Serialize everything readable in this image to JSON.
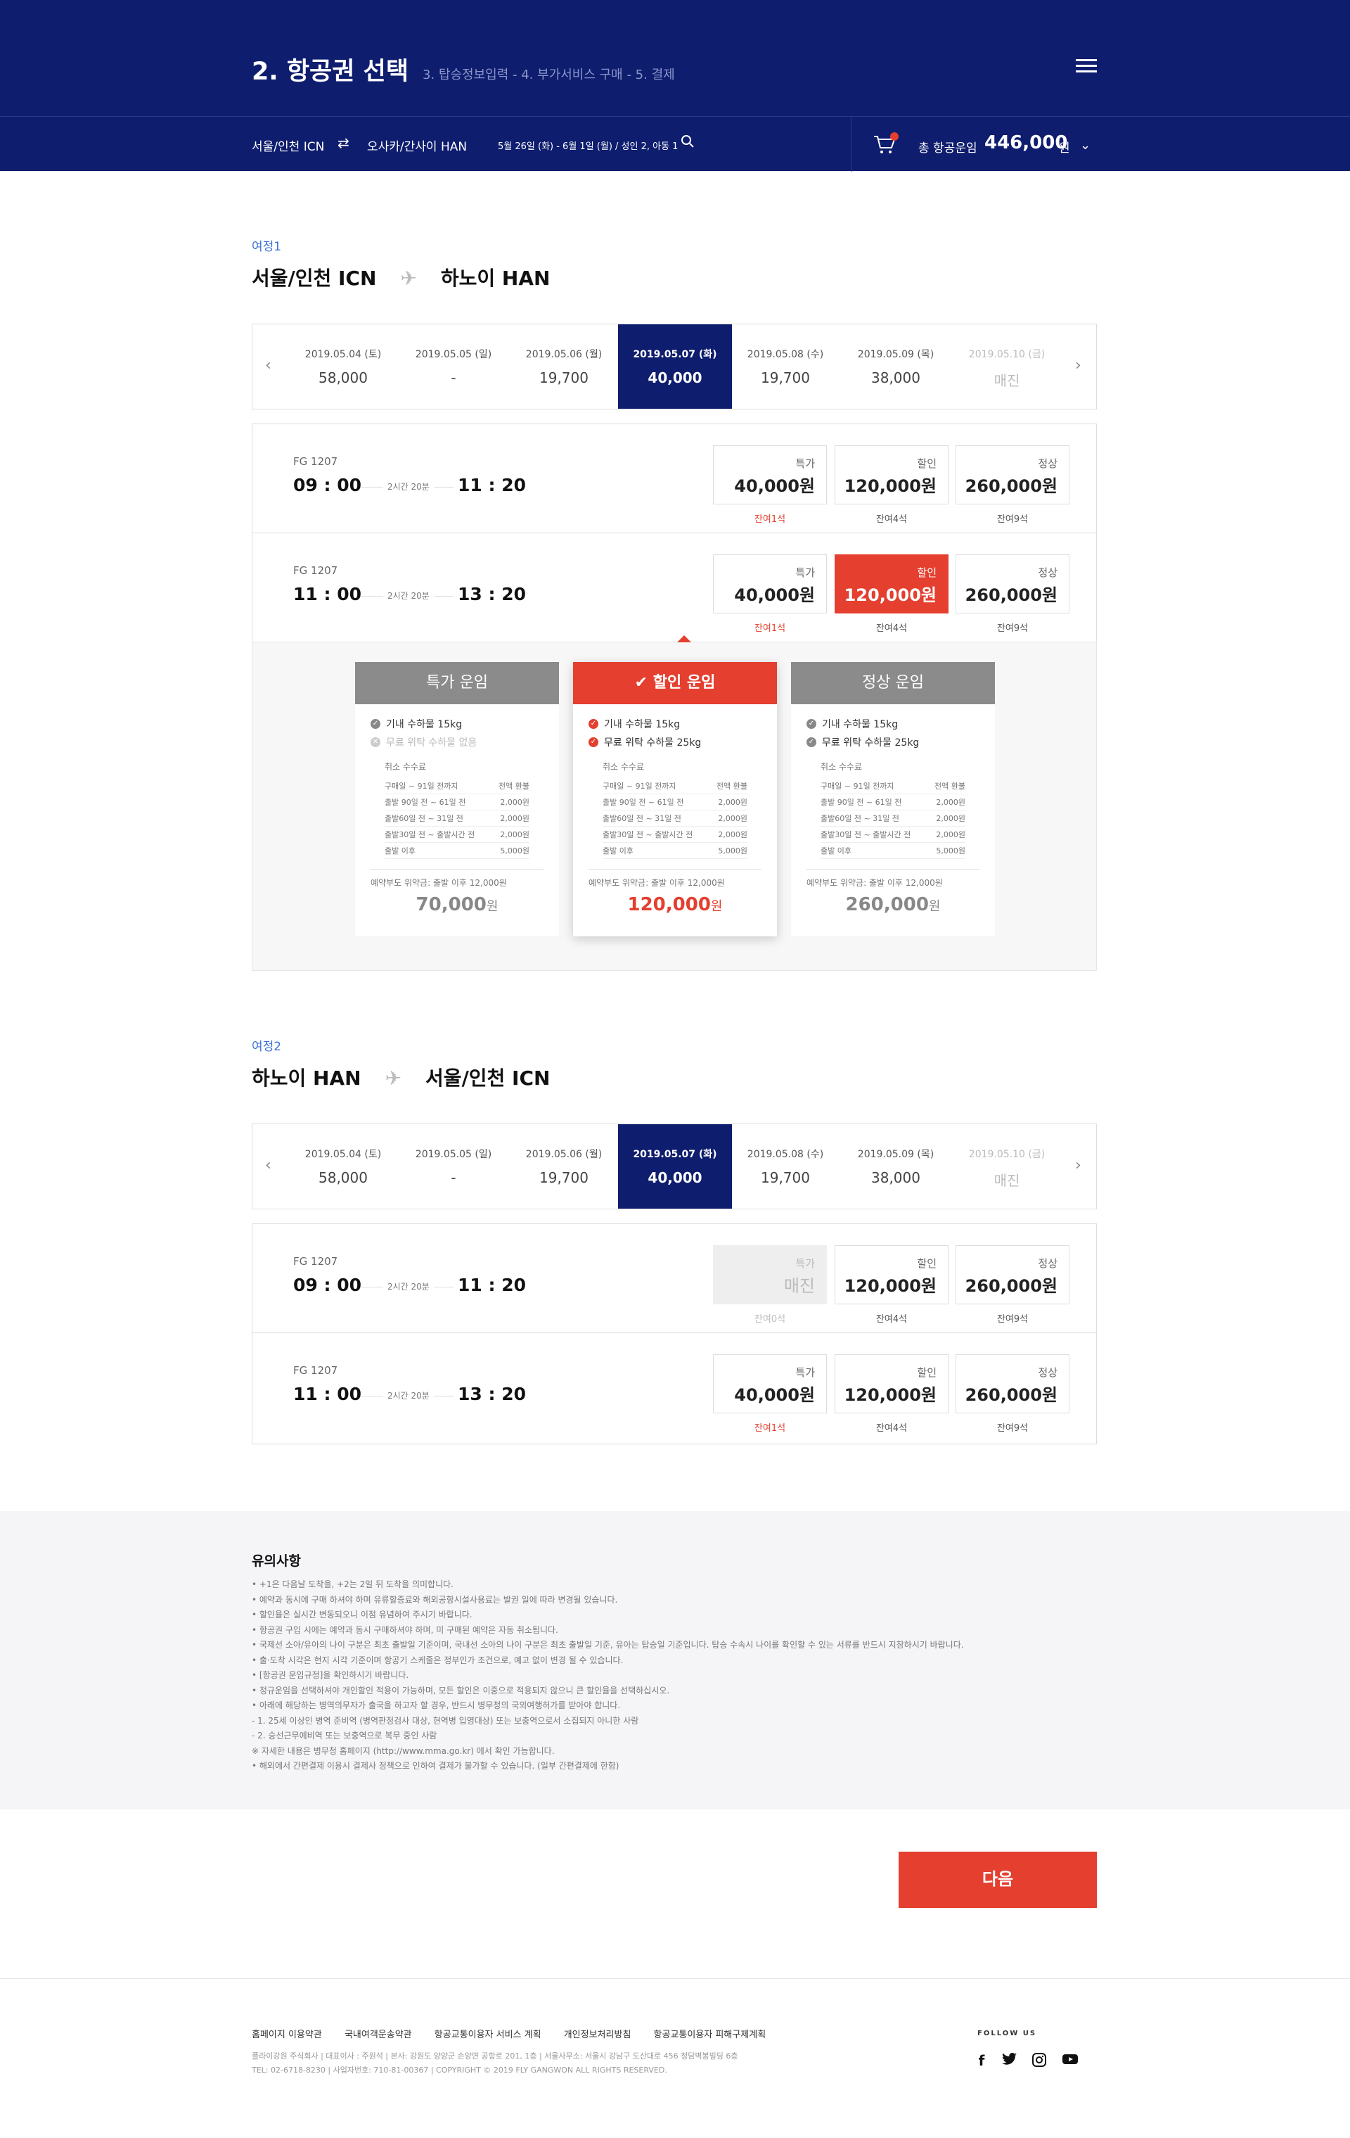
{
  "header": {
    "step_title": "2. 항공권 선택",
    "step_sub": "3. 탑승정보입력 - 4. 부가서비스 구매 - 5. 결제"
  },
  "searchbar": {
    "from": "서울/인천 ICN",
    "to": "오사카/간사이 HAN",
    "summary": "5월 26일 (화) - 6월 1일 (월) / 성인 2, 아동 1",
    "total_label": "총 항공운임",
    "total_price": "446,000",
    "total_unit": "원"
  },
  "trips": [
    {
      "label": "여정1",
      "from": "서울/인천 ICN",
      "to": "하노이 HAN",
      "dates": [
        {
          "d": "2019.05.04 (토)",
          "p": "58,000"
        },
        {
          "d": "2019.05.05 (일)",
          "p": "-"
        },
        {
          "d": "2019.05.06 (월)",
          "p": "19,700"
        },
        {
          "d": "2019.05.07 (화)",
          "p": "40,000"
        },
        {
          "d": "2019.05.08 (수)",
          "p": "19,700"
        },
        {
          "d": "2019.05.09 (목)",
          "p": "38,000"
        },
        {
          "d": "2019.05.10 (금)",
          "p": "매진"
        }
      ],
      "flights": [
        {
          "no": "FG 1207",
          "dep": "09 : 00",
          "dur": "2시간 20분",
          "arr": "11 : 20",
          "fares": [
            {
              "k": "특가",
              "v": "40,000원",
              "s": "잔여1석"
            },
            {
              "k": "할인",
              "v": "120,000원",
              "s": "잔여4석"
            },
            {
              "k": "정상",
              "v": "260,000원",
              "s": "잔여9석"
            }
          ]
        },
        {
          "no": "FG 1207",
          "dep": "11 : 00",
          "dur": "2시간 20분",
          "arr": "13 : 20",
          "fares": [
            {
              "k": "특가",
              "v": "40,000원",
              "s": "잔여1석"
            },
            {
              "k": "할인",
              "v": "120,000원",
              "s": "잔여4석"
            },
            {
              "k": "정상",
              "v": "260,000원",
              "s": "잔여9석"
            }
          ]
        }
      ]
    },
    {
      "label": "여정2",
      "from": "하노이 HAN",
      "to": "서울/인천 ICN",
      "dates": [
        {
          "d": "2019.05.04 (토)",
          "p": "58,000"
        },
        {
          "d": "2019.05.05 (일)",
          "p": "-"
        },
        {
          "d": "2019.05.06 (월)",
          "p": "19,700"
        },
        {
          "d": "2019.05.07 (화)",
          "p": "40,000"
        },
        {
          "d": "2019.05.08 (수)",
          "p": "19,700"
        },
        {
          "d": "2019.05.09 (목)",
          "p": "38,000"
        },
        {
          "d": "2019.05.10 (금)",
          "p": "매진"
        }
      ],
      "flights": [
        {
          "no": "FG 1207",
          "dep": "09 : 00",
          "dur": "2시간 20분",
          "arr": "11 : 20",
          "fares": [
            {
              "k": "특가",
              "v": "매진",
              "s": "잔여0석"
            },
            {
              "k": "할인",
              "v": "120,000원",
              "s": "잔여4석"
            },
            {
              "k": "정상",
              "v": "260,000원",
              "s": "잔여9석"
            }
          ]
        },
        {
          "no": "FG 1207",
          "dep": "11 : 00",
          "dur": "2시간 20분",
          "arr": "13 : 20",
          "fares": [
            {
              "k": "특가",
              "v": "40,000원",
              "s": "잔여1석"
            },
            {
              "k": "할인",
              "v": "120,000원",
              "s": "잔여4석"
            },
            {
              "k": "정상",
              "v": "260,000원",
              "s": "잔여9석"
            }
          ]
        }
      ]
    }
  ],
  "fare_cards": [
    {
      "title": "특가 운임",
      "b1": "기내 수하물 15kg",
      "b2": "무료 위탁 수하물 없음",
      "price": "70,000",
      "unit": "원"
    },
    {
      "title": "할인 운임",
      "b1": "기내 수하물 15kg",
      "b2": "무료 위탁 수하물 25kg",
      "price": "120,000",
      "unit": "원"
    },
    {
      "title": "정상 운임",
      "b1": "기내 수하물 15kg",
      "b2": "무료 위탁 수하물 25kg",
      "price": "260,000",
      "unit": "원"
    }
  ],
  "cancel": {
    "title": "취소 수수료",
    "rows": [
      {
        "k": "구매일 ~ 91일 전까지",
        "v": "전액 환불"
      },
      {
        "k": "출발 90일 전 ~ 61일 전",
        "v": "2,000원"
      },
      {
        "k": "출발60일 전 ~ 31일 전",
        "v": "2,000원"
      },
      {
        "k": "출발30일 전 ~ 출발시간 전",
        "v": "2,000원"
      },
      {
        "k": "출발 이후",
        "v": "5,000원"
      }
    ],
    "noshow": "예약부도 위약금: 출발 이후 12,000원"
  },
  "notice": {
    "title": "유의사항",
    "items": [
      "• +1은 다음날 도착을, +2는 2일 뒤 도착을 의미합니다.",
      "• 예약과 동시에 구매 하셔야 하며 유류할증료와 해외공항시설사용료는 발권 일에 따라 변경될 있습니다.",
      "• 할인율은 실시간 변동되오니 이점 유념하여 주시기 바랍니다.",
      "• 항공권 구입 시에는 예약과 동시 구매하셔야 하며, 미 구매된 예약은 자동 취소됩니다.",
      "• 국제선 소아/유아의 나이 구분은 최초 출발일 기준이며, 국내선 소아의 나이 구분은 최초 출발일 기준, 유아는 탑승일 기준입니다. 탑승 수속시 나이를 확인할 수 있는 서류를 반드시 지참하시기 바랍니다.",
      "• 출·도착 시각은 현지 시각 기준이며 항공기 스케줄은 정부인가 조건으로, 예고 없이 변경 될 수 있습니다.",
      "• [항공권 운임규정]을 확인하시기 바랍니다.",
      "• 정규운임을 선택하셔야 개인할인 적용이 가능하며, 모든 할인은 이중으로 적용되지 않으니 큰 할인율을 선택하십시오.",
      "• 아래에 해당하는 병역의무자가 출국을 하고자 할 경우, 반드시 병무청의 국외여행허가를 받아야 합니다.",
      "   - 1. 25세 이상인 병역 준비역 (병역판정검사 대상, 현역병 입영대상) 또는 보충역으로서 소집되지 아니한 사람",
      "   - 2. 승선근무예비역 또는 보충역으로 복무 중인 사람",
      "   ※ 자세한 내용은 병무청 홈페이지 (http://www.mma.go.kr) 에서 확인 가능합니다.",
      "• 해외에서 간편결제 이용시 결제사 정책으로 인하여 결제가 불가할 수 있습니다. (일부 간편결제에 한함)"
    ]
  },
  "next_label": "다음",
  "footer": {
    "links": [
      "홈페이지 이용약관",
      "국내여객운송약관",
      "항공교통이용자 서비스 계획",
      "개인정보처리방침",
      "항공교통이용자 피해구제계획"
    ],
    "addr1": "플라이강원 주식회사 | 대표이사 : 주원석 | 본사: 강원도 양양군 손양면 공항로 201, 1층 | 서울사무소: 서울시 강남구 도산대로 456 청담벽봉빌딩 6층",
    "addr2": "TEL: 02-6718-8230 | 사업자번호: 710-81-00367 | COPYRIGHT © 2019 FLY GANGWON ALL RIGHTS RESERVED.",
    "follow": "FOLLOW US"
  },
  "colors": {
    "navy": "#0e1d6e",
    "accent": "#e43f2f"
  }
}
